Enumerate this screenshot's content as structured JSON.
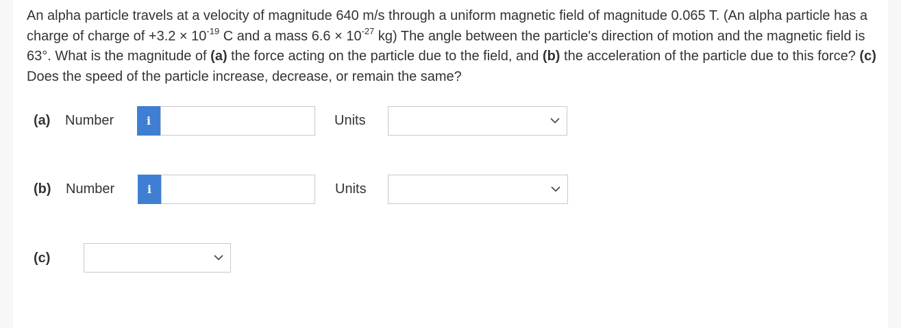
{
  "question": {
    "s1": "An alpha particle travels at a velocity of magnitude 640 m/s through a uniform magnetic field of magnitude 0.065 T. (An alpha particle has a charge of charge of +3.2 × 10",
    "exp1": "-19",
    "s2": " C and a mass 6.6 × 10",
    "exp2": "-27",
    "s3": " kg) The angle between the particle's direction of motion and the magnetic field is 63°. What is the magnitude of ",
    "part_a": "(a)",
    "s4": " the force acting on the particle due to the field, and ",
    "part_b": "(b)",
    "s5": " the acceleration of the particle due to this force? ",
    "part_c": "(c)",
    "s6": " Does the speed of the particle increase, decrease, or remain the same?"
  },
  "parts": {
    "a": {
      "label": "(a)",
      "number_label": "Number",
      "info_icon": "i",
      "value": "",
      "units_label": "Units",
      "units_selected": ""
    },
    "b": {
      "label": "(b)",
      "number_label": "Number",
      "info_icon": "i",
      "value": "",
      "units_label": "Units",
      "units_selected": ""
    },
    "c": {
      "label": "(c)",
      "selected": ""
    }
  },
  "colors": {
    "info_button": "#3f7fd3",
    "text": "#333333",
    "border": "#c8c8c8"
  }
}
